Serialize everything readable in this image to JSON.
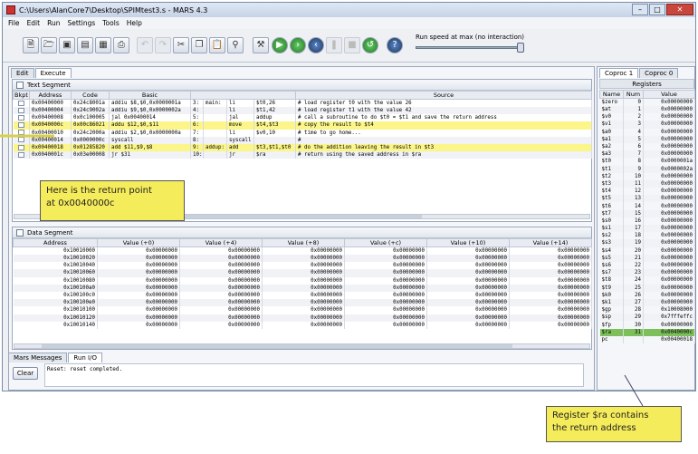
{
  "window": {
    "title": "C:\\Users\\AlanCore7\\Desktop\\SPIMtest3.s - MARS 4.3"
  },
  "menu": [
    "File",
    "Edit",
    "Run",
    "Settings",
    "Tools",
    "Help"
  ],
  "toolbar": {
    "speed_label": "Run speed at max (no interaction)"
  },
  "tabs": {
    "edit": "Edit",
    "execute": "Execute"
  },
  "text_segment": {
    "title": "Text Segment",
    "columns": [
      "Bkpt",
      "Address",
      "Code",
      "Basic",
      "",
      "",
      "",
      "Source"
    ],
    "rows": [
      {
        "address": "0x00400000",
        "code": "0x24c8001a",
        "basic": "addiu $8,$0,0x0000001a",
        "line": "3:",
        "label": "main:",
        "op": "li",
        "args": "$t0,26",
        "comment": "# load register t0 with the value 26"
      },
      {
        "address": "0x00400004",
        "code": "0x24c9002a",
        "basic": "addiu $9,$0,0x0000002a",
        "line": "4:",
        "label": "",
        "op": "li",
        "args": "$t1,42",
        "comment": "# load register t1 with the value 42"
      },
      {
        "address": "0x00400008",
        "code": "0x0c100005",
        "basic": "jal 0x00400014",
        "line": "5:",
        "label": "",
        "op": "jal",
        "args": "addup",
        "comment": "# call a subroutine to do $t0 = $t1 and save the return address"
      },
      {
        "address": "0x0040000c",
        "code": "0x00c86021",
        "basic": "addu $12,$0,$11",
        "line": "6:",
        "label": "",
        "op": "move",
        "args": "$t4,$t3",
        "comment": "# copy the result to $t4"
      },
      {
        "address": "0x00400010",
        "code": "0x24c2000a",
        "basic": "addiu $2,$0,0x0000000a",
        "line": "7:",
        "label": "",
        "op": "li",
        "args": "$v0,10",
        "comment": "# time to go home..."
      },
      {
        "address": "0x00400014",
        "code": "0x0000000c",
        "basic": "syscall",
        "line": "8:",
        "label": "",
        "op": "syscall",
        "args": "",
        "comment": "#"
      },
      {
        "address": "0x00400018",
        "code": "0x01285820",
        "basic": "add $11,$9,$8",
        "line": "9:",
        "label": "addup:",
        "op": "add",
        "args": "$t3,$t1,$t0",
        "comment": "# do the addition leaving the result in $t3"
      },
      {
        "address": "0x0040001c",
        "code": "0x03e00008",
        "basic": "jr $31",
        "line": "10:",
        "label": "",
        "op": "jr",
        "args": "$ra",
        "comment": "# return using the saved address in $ra"
      }
    ]
  },
  "data_segment": {
    "title": "Data Segment",
    "columns": [
      "Address",
      "Value (+0)",
      "Value (+4)",
      "Value (+8)",
      "Value (+c)",
      "Value (+10)",
      "Value (+14)"
    ],
    "addresses": [
      "0x10010000",
      "0x10010020",
      "0x10010040",
      "0x10010060",
      "0x10010080",
      "0x100100a0",
      "0x100100c0",
      "0x100100e0",
      "0x10010100",
      "0x10010120",
      "0x10010140"
    ],
    "value": "0x00000000"
  },
  "messages": {
    "tabs": [
      "Mars Messages",
      "Run I/O"
    ],
    "clear_label": "Clear",
    "text": "Reset: reset completed."
  },
  "registers": {
    "tabs": [
      "Coproc 1",
      "Coproc 0"
    ],
    "title": "Registers",
    "columns": [
      "Name",
      "Num",
      "Value"
    ],
    "rows": [
      [
        "$zero",
        "0",
        "0x00000000"
      ],
      [
        "$at",
        "1",
        "0x00000000"
      ],
      [
        "$v0",
        "2",
        "0x00000000"
      ],
      [
        "$v1",
        "3",
        "0x00000000"
      ],
      [
        "$a0",
        "4",
        "0x00000000"
      ],
      [
        "$a1",
        "5",
        "0x00000000"
      ],
      [
        "$a2",
        "6",
        "0x00000000"
      ],
      [
        "$a3",
        "7",
        "0x00000000"
      ],
      [
        "$t0",
        "8",
        "0x0000001a"
      ],
      [
        "$t1",
        "9",
        "0x0000002a"
      ],
      [
        "$t2",
        "10",
        "0x00000000"
      ],
      [
        "$t3",
        "11",
        "0x00000000"
      ],
      [
        "$t4",
        "12",
        "0x00000000"
      ],
      [
        "$t5",
        "13",
        "0x00000000"
      ],
      [
        "$t6",
        "14",
        "0x00000000"
      ],
      [
        "$t7",
        "15",
        "0x00000000"
      ],
      [
        "$s0",
        "16",
        "0x00000000"
      ],
      [
        "$s1",
        "17",
        "0x00000000"
      ],
      [
        "$s2",
        "18",
        "0x00000000"
      ],
      [
        "$s3",
        "19",
        "0x00000000"
      ],
      [
        "$s4",
        "20",
        "0x00000000"
      ],
      [
        "$s5",
        "21",
        "0x00000000"
      ],
      [
        "$s6",
        "22",
        "0x00000000"
      ],
      [
        "$s7",
        "23",
        "0x00000000"
      ],
      [
        "$t8",
        "24",
        "0x00000000"
      ],
      [
        "$t9",
        "25",
        "0x00000000"
      ],
      [
        "$k0",
        "26",
        "0x00000000"
      ],
      [
        "$k1",
        "27",
        "0x00000000"
      ],
      [
        "$gp",
        "28",
        "0x10008000"
      ],
      [
        "$sp",
        "29",
        "0x7fffeffc"
      ],
      [
        "$fp",
        "30",
        "0x00000000"
      ],
      [
        "$ra",
        "31",
        "0x0040000c"
      ],
      [
        "pc",
        "",
        "0x00400018"
      ]
    ]
  },
  "annotations": {
    "return_point": [
      "Here is the return point",
      "at 0x0040000c"
    ],
    "register_ra": [
      "Register $ra contains",
      "the return address"
    ]
  },
  "colors": {
    "highlight": "#fbf58a",
    "register_highlight": "#7dc05b",
    "callout": "#f5ec5b"
  }
}
